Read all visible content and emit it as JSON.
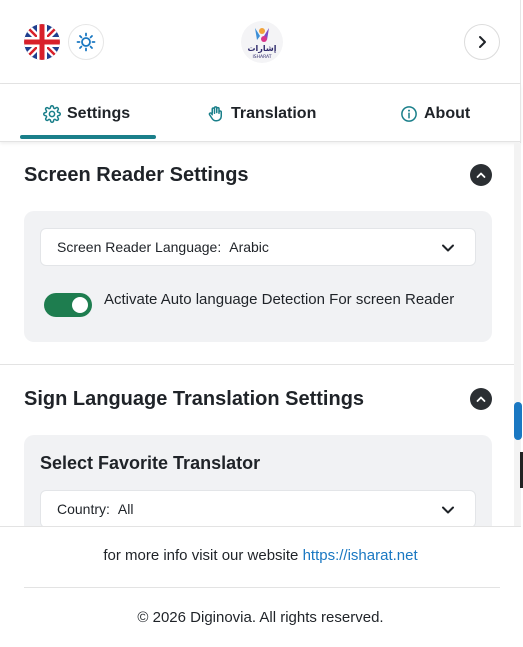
{
  "header": {
    "language_flag_icon": "uk-flag-icon",
    "theme_icon": "sun-icon",
    "logo_text": "إشارات",
    "logo_subtext": "ISHARAT",
    "next_icon": "chevron-right-icon"
  },
  "tabs": [
    {
      "label": "Settings",
      "icon": "gear-icon",
      "active": true
    },
    {
      "label": "Translation",
      "icon": "hand-icon",
      "active": false
    },
    {
      "label": "About",
      "icon": "info-icon",
      "active": false
    }
  ],
  "screen_reader": {
    "title": "Screen Reader Settings",
    "language_label": "Screen Reader Language:",
    "language_value": "Arabic",
    "auto_detect_label": "Activate Auto language Detection For screen Reader",
    "auto_detect_on": true
  },
  "sign_language": {
    "title": "Sign Language Translation Settings",
    "favorite_heading": "Select Favorite Translator",
    "country_label": "Country:",
    "country_value": "All"
  },
  "footer": {
    "info_text": "for more info visit our website",
    "link_text": "https://isharat.net",
    "copyright": "© 2026 Diginovia. All rights reserved."
  },
  "colors": {
    "accent": "#1a7f8a",
    "toggle_on": "#1e7d4f",
    "link": "#1a78c2",
    "card_bg": "#f1f2f4"
  }
}
